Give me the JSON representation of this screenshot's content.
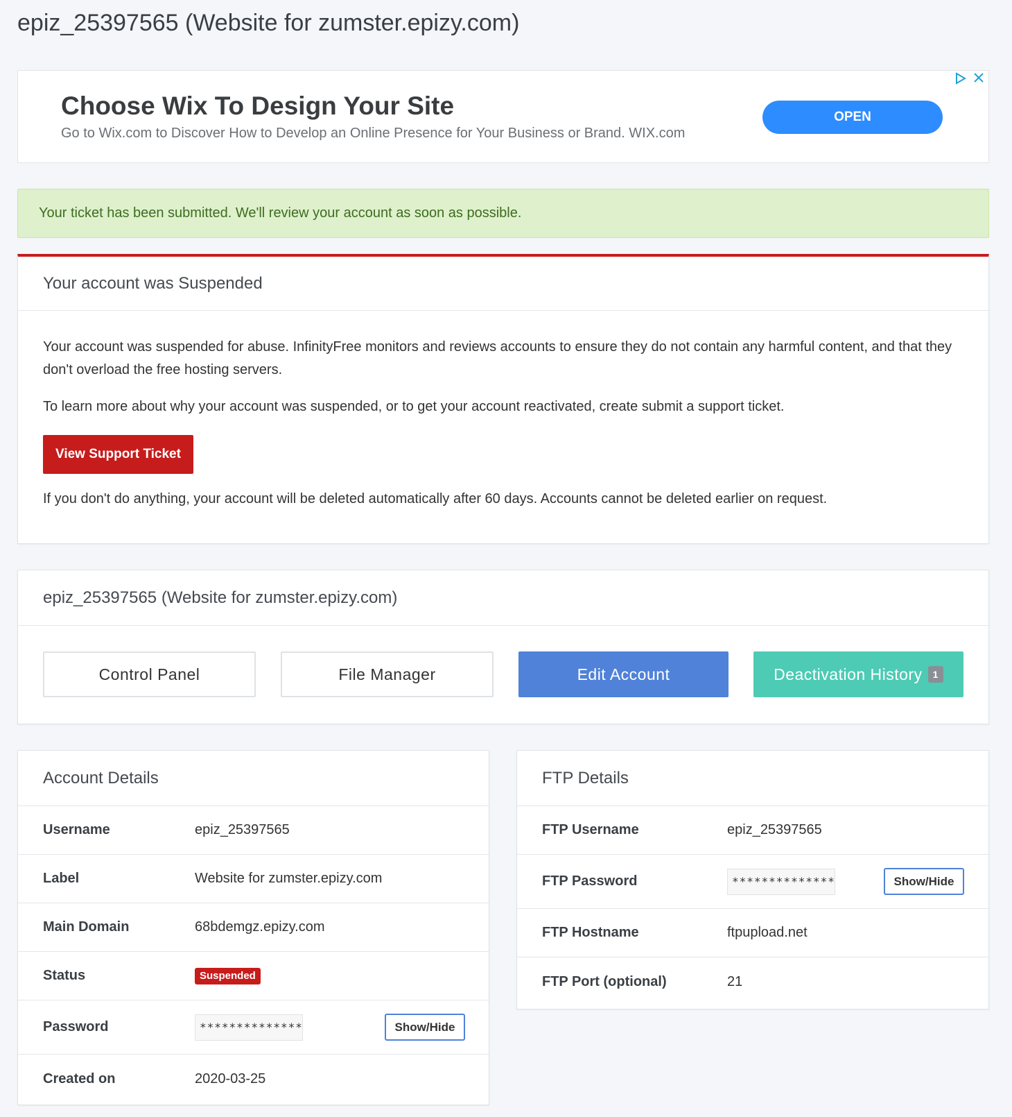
{
  "page_title": "epiz_25397565 (Website for zumster.epizy.com)",
  "ad": {
    "title": "Choose Wix To Design Your Site",
    "description": "Go to Wix.com to Discover How to Develop an Online Presence for Your Business or Brand. WIX.com",
    "open_label": "OPEN",
    "adchoices_icon": "adchoices-icon",
    "close_icon": "close-icon"
  },
  "alert": {
    "text": "Your ticket has been submitted. We'll review your account as soon as possible."
  },
  "suspended": {
    "title": "Your account was Suspended",
    "para1": "Your account was suspended for abuse. InfinityFree monitors and reviews accounts to ensure they do not contain any harmful content, and that they don't overload the free hosting servers.",
    "para2": "To learn more about why your account was suspended, or to get your account reactivated, create submit a support ticket.",
    "button": "View Support Ticket",
    "para3": "If you don't do anything, your account will be deleted automatically after 60 days. Accounts cannot be deleted earlier on request."
  },
  "account_card": {
    "title": "epiz_25397565 (Website for zumster.epizy.com)",
    "actions": {
      "control_panel": "Control Panel",
      "file_manager": "File Manager",
      "edit_account": "Edit Account",
      "deactivation_history": "Deactivation History",
      "deactivation_count": "1"
    }
  },
  "account_details": {
    "title": "Account Details",
    "username_label": "Username",
    "username": "epiz_25397565",
    "label_label": "Label",
    "label": "Website for zumster.epizy.com",
    "domain_label": "Main Domain",
    "domain": "68bdemgz.epizy.com",
    "status_label": "Status",
    "status": "Suspended",
    "password_label": "Password",
    "password": "**************",
    "show_hide": "Show/Hide",
    "created_label": "Created on",
    "created": "2020-03-25"
  },
  "ftp_details": {
    "title": "FTP Details",
    "username_label": "FTP Username",
    "username": "epiz_25397565",
    "password_label": "FTP Password",
    "password": "**************",
    "show_hide": "Show/Hide",
    "hostname_label": "FTP Hostname",
    "hostname": "ftpupload.net",
    "port_label": "FTP Port (optional)",
    "port": "21"
  },
  "colors": {
    "danger": "#c71c1c",
    "primary": "#4f82d8",
    "teal": "#4dcbb4",
    "ad_button": "#2d8cff",
    "success_bg": "#dff0cc"
  }
}
